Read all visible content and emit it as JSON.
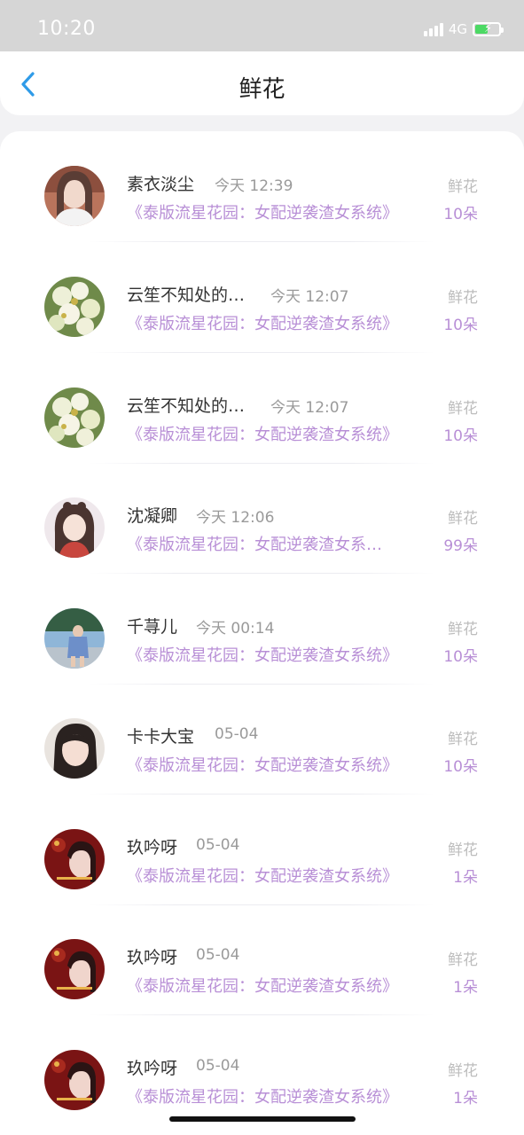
{
  "status_bar": {
    "time": "10:20",
    "network": "4G"
  },
  "nav": {
    "title": "鲜花"
  },
  "gifts": [
    {
      "name": "素衣淡尘",
      "time": "今天 12:39",
      "type": "鲜花",
      "book": "《泰版流星花园：女配逆袭渣女系统》",
      "amount": "10朵",
      "avatar": "girl-photo-avatar"
    },
    {
      "name": "云笙不知处的…",
      "time": "今天 12:07",
      "type": "鲜花",
      "book": "《泰版流星花园：女配逆袭渣女系统》",
      "amount": "10朵",
      "avatar": "white-flowers-avatar"
    },
    {
      "name": "云笙不知处的…",
      "time": "今天 12:07",
      "type": "鲜花",
      "book": "《泰版流星花园：女配逆袭渣女系统》",
      "amount": "10朵",
      "avatar": "white-flowers-avatar"
    },
    {
      "name": "沈凝卿",
      "time": "今天 12:06",
      "type": "鲜花",
      "book": "《泰版流星花园：女配逆袭渣女系…",
      "amount": "99朵",
      "avatar": "anime-girl-avatar"
    },
    {
      "name": "千荨儿",
      "time": "今天 00:14",
      "type": "鲜花",
      "book": "《泰版流星花园：女配逆袭渣女系统》",
      "amount": "10朵",
      "avatar": "street-photo-avatar"
    },
    {
      "name": "卡卡大宝",
      "time": "05-04",
      "type": "鲜花",
      "book": "《泰版流星花园：女配逆袭渣女系统》",
      "amount": "10朵",
      "avatar": "selfie-avatar"
    },
    {
      "name": "玖吟呀",
      "time": "05-04",
      "type": "鲜花",
      "book": "《泰版流星花园：女配逆袭渣女系统》",
      "amount": "1朵",
      "avatar": "red-poster-avatar"
    },
    {
      "name": "玖吟呀",
      "time": "05-04",
      "type": "鲜花",
      "book": "《泰版流星花园：女配逆袭渣女系统》",
      "amount": "1朵",
      "avatar": "red-poster-avatar"
    },
    {
      "name": "玖吟呀",
      "time": "05-04",
      "type": "鲜花",
      "book": "《泰版流星花园：女配逆袭渣女系统》",
      "amount": "1朵",
      "avatar": "red-poster-avatar"
    }
  ],
  "colors": {
    "accent": "#b88fd6",
    "back": "#2f9be8",
    "label": "#bdbdbd"
  }
}
